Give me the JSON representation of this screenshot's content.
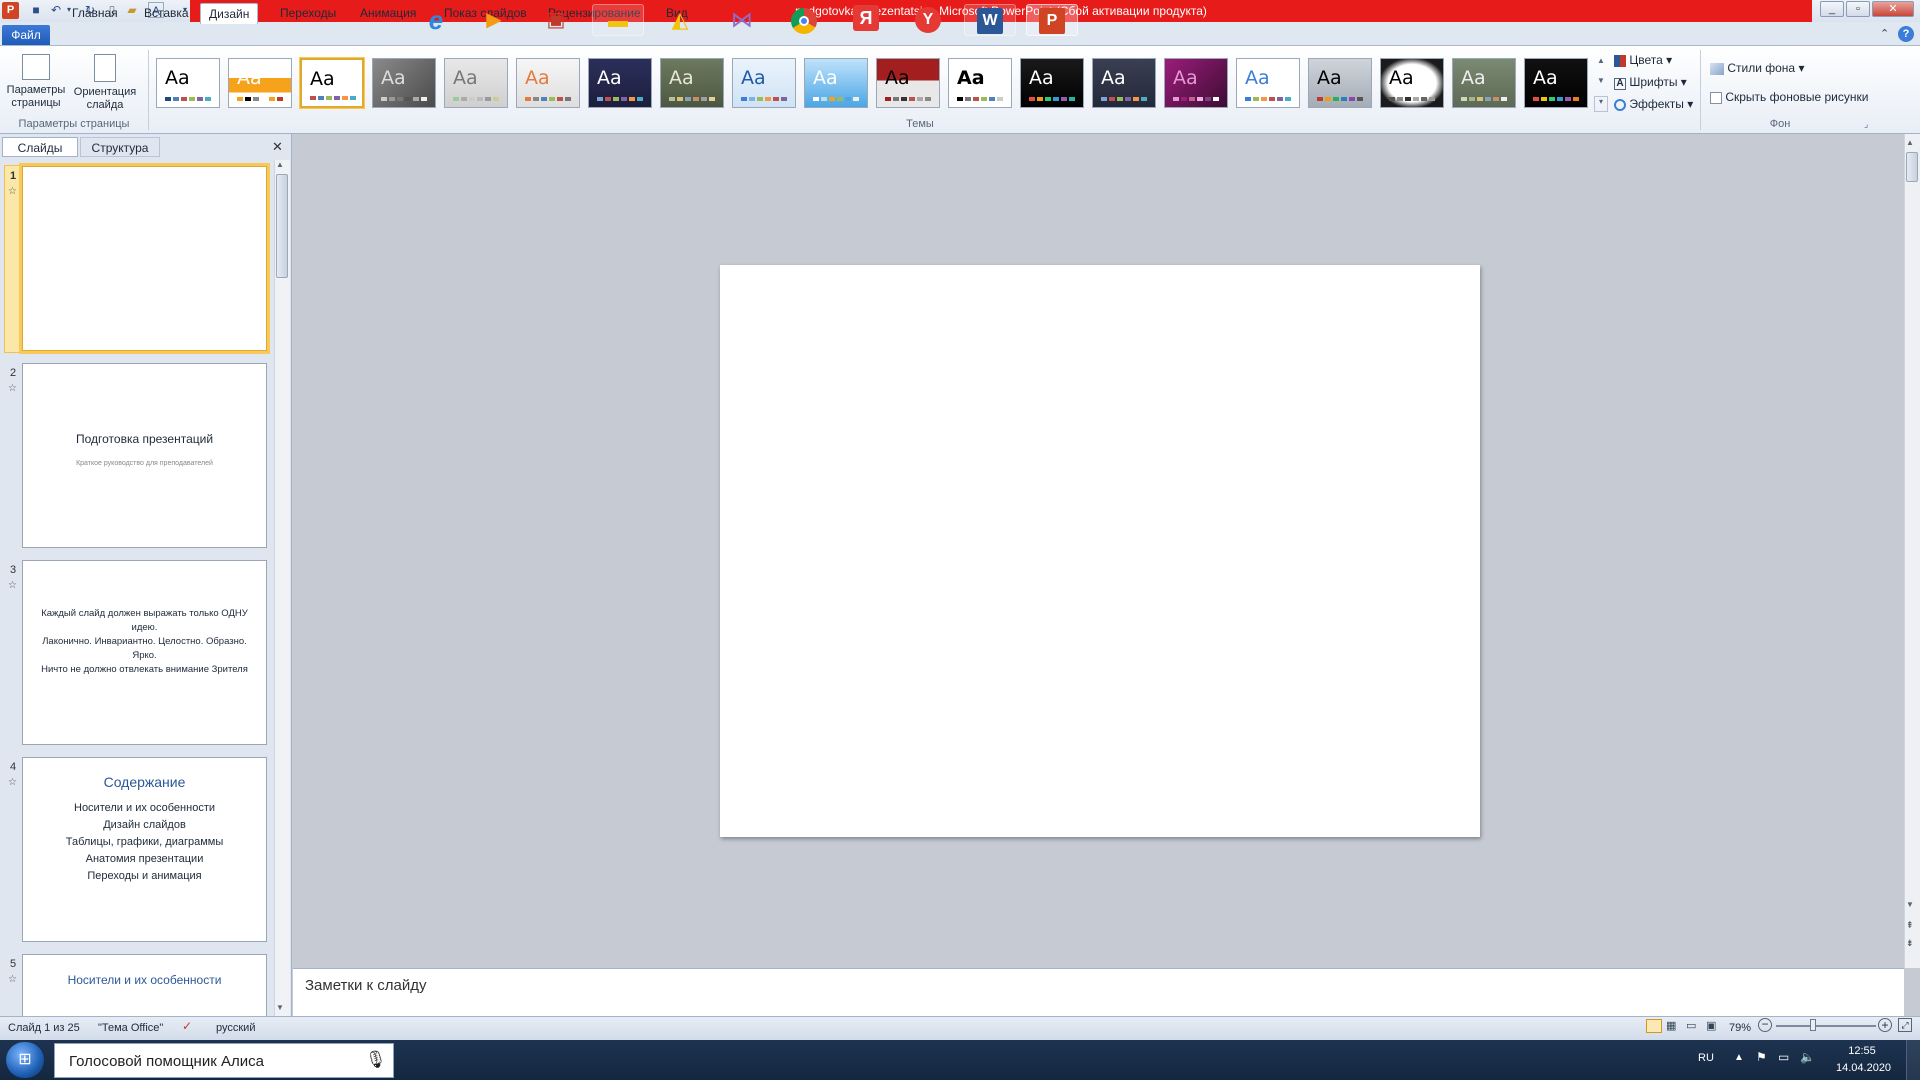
{
  "window": {
    "title": "podgotovka_prezentatsiy - Microsoft PowerPoint (Сбой активации продукта)"
  },
  "tabs": {
    "file": "Файл",
    "items": [
      "Главная",
      "Вставка",
      "Дизайн",
      "Переходы",
      "Анимация",
      "Показ слайдов",
      "Рецензирование",
      "Вид"
    ],
    "active": "Дизайн"
  },
  "ribbon": {
    "page_setup": {
      "label": "Параметры страницы",
      "button1": "Параметры страницы",
      "button2": "Ориентация слайда"
    },
    "themes_label": "Темы",
    "theme_text": "Aa",
    "colors": "Цвета",
    "fonts": "Шрифты",
    "effects": "Эффекты",
    "bg_styles": "Стили фона",
    "hide_bg": "Скрыть фоновые рисунки",
    "bg_label": "Фон"
  },
  "panel": {
    "tab_slides": "Слайды",
    "tab_outline": "Структура"
  },
  "slides": [
    {
      "num": "1"
    },
    {
      "num": "2",
      "title": "Подготовка презентаций",
      "subtitle": "Краткое руководство для преподавателей"
    },
    {
      "num": "3",
      "line1": "Каждый слайд должен выражать только ОДНУ идею.",
      "line2": "Лаконично. Инвариантно. Целостно. Образно. Ярко.",
      "line3": "Ничто не должно отвлекать внимание Зрителя"
    },
    {
      "num": "4",
      "title": "Содержание",
      "items": [
        "Носители и их особенности",
        "Дизайн слайдов",
        "Таблицы, графики, диаграммы",
        "Анатомия презентации",
        "Переходы и анимация"
      ]
    },
    {
      "num": "5",
      "title": "Носители и их особенности"
    }
  ],
  "notes": {
    "placeholder": "Заметки к слайду"
  },
  "status": {
    "slide": "Слайд 1 из 25",
    "theme": "\"Тема Office\"",
    "lang": "русский",
    "zoom": "79%"
  },
  "taskbar": {
    "search": "Голосовой помощник Алиса",
    "lang": "RU",
    "time": "12:55",
    "date": "14.04.2020"
  },
  "colors": {
    "title_bar_alert": "#e81b1b",
    "taskbar": "#1d3350",
    "selected_slide": "#f6c95a",
    "accent_blue": "#2b5797"
  }
}
